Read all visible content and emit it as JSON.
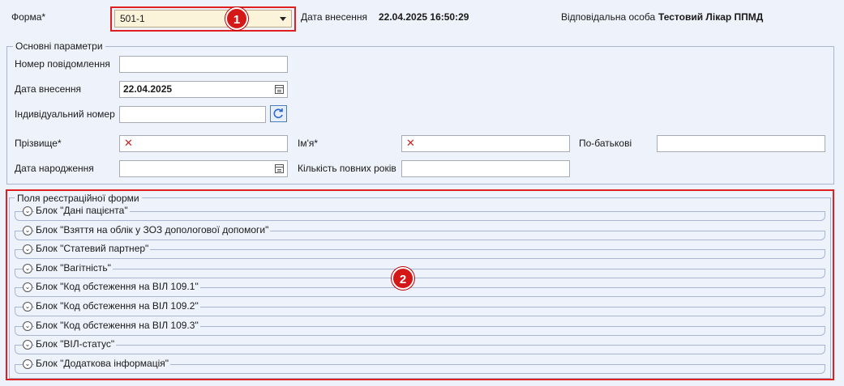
{
  "header": {
    "form_label": "Форма*",
    "form_value": "501-1",
    "entry_date_label": "Дата внесення",
    "entry_date_value": "22.04.2025 16:50:29",
    "responsible_label": "Відповідальна особа",
    "responsible_value": "Тестовий Лікар ППМД"
  },
  "main_params": {
    "legend": "Основні параметри",
    "message_number_label": "Номер повідомлення",
    "message_number_value": "",
    "entry_date_label": "Дата внесення",
    "entry_date_value": "22.04.2025",
    "individual_number_label": "Індивідуальний номер",
    "individual_number_value": "",
    "surname_label": "Прізвище*",
    "name_label": "Ім'я*",
    "patronymic_label": "По-батькові",
    "birth_date_label": "Дата народження",
    "full_years_label": "Кількість повних років",
    "required_mark": "✕"
  },
  "registration_fields": {
    "legend": "Поля реєстраційної форми",
    "blocks": [
      "Блок \"Дані пацієнта\"",
      "Блок \"Взяття на облік у ЗОЗ дополог​ової допомоги\"",
      "Блок \"Статевий партнер\"",
      "Блок \"Вагітність\"",
      "Блок \"Код обстеження на ВІЛ 109.1\"",
      "Блок \"Код обстеження на ВІЛ 109.2\"",
      "Блок \"Код обстеження на ВІЛ 109.3\"",
      "Блок \"ВІЛ-статус\"",
      "Блок \"Додаткова інформація\""
    ]
  },
  "annotations": {
    "badge1": "1",
    "badge2": "2"
  },
  "icons": {
    "dropdown": "caret-down-icon",
    "calendar": "calendar-icon",
    "refresh": "refresh-icon",
    "expand": "chevron-down-icon"
  },
  "colors": {
    "highlight": "#e02020",
    "background": "#eef2fa",
    "border": "#a9b6d3"
  }
}
